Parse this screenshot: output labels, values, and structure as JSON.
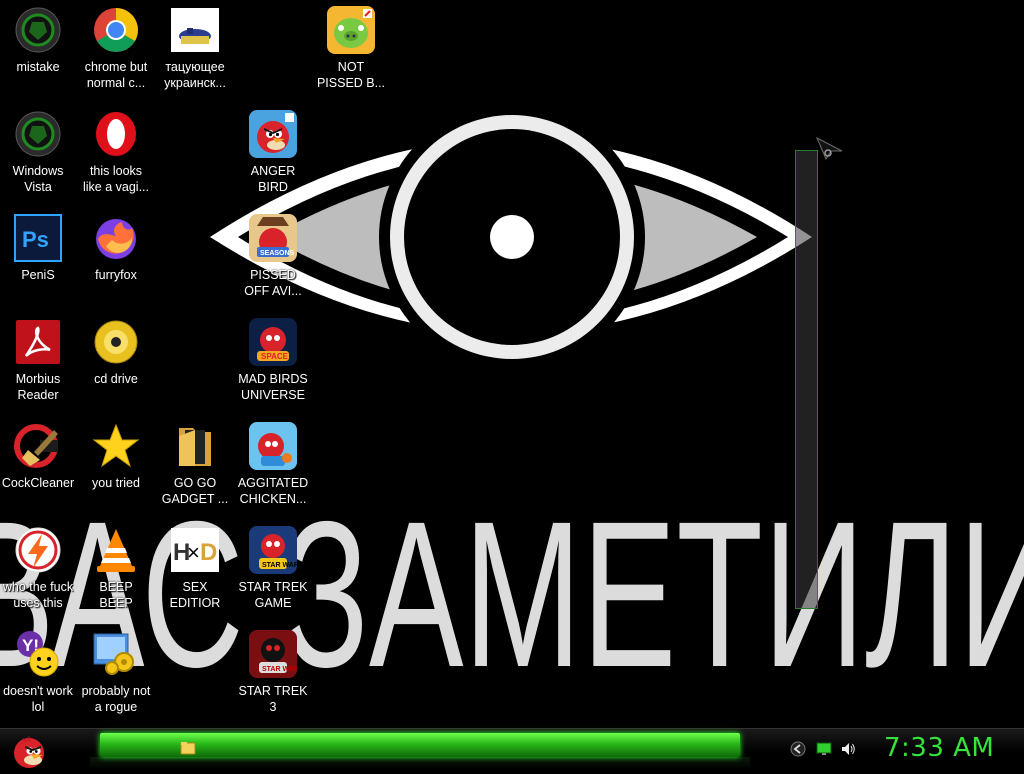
{
  "wallpaper": {
    "text": "ВАС ЗАМЕТИЛИ"
  },
  "desktop_icons": [
    {
      "id": "mistake",
      "label": "mistake",
      "icon": "razer-logo-icon"
    },
    {
      "id": "chrome",
      "label": "chrome but\nnormal c...",
      "icon": "chrome-icon"
    },
    {
      "id": "img-ru",
      "label": "тацующее\nукраинск...",
      "icon": "image-thumbnail-icon"
    },
    {
      "id": "not-pissed",
      "label": "NOT\nPISSED B...",
      "icon": "angry-birds-pig-icon"
    },
    {
      "id": "windows-vista",
      "label": "Windows\nVista",
      "icon": "razer-logo-icon"
    },
    {
      "id": "opera",
      "label": "this looks\nlike a vagi...",
      "icon": "opera-icon"
    },
    {
      "id": "anger-bird",
      "label": "ANGER\nBIRD",
      "icon": "angry-birds-icon"
    },
    {
      "id": "photoshop",
      "label": "PeniS",
      "icon": "photoshop-icon"
    },
    {
      "id": "firefox",
      "label": "furryfox",
      "icon": "firefox-icon"
    },
    {
      "id": "pissed-off",
      "label": "PISSED\nOFF AVI...",
      "icon": "angry-birds-seasons-icon"
    },
    {
      "id": "acrobat",
      "label": "Morbius\nReader",
      "icon": "acrobat-icon"
    },
    {
      "id": "cd-drive",
      "label": "cd drive",
      "icon": "cd-icon"
    },
    {
      "id": "mad-birds",
      "label": "MAD BIRDS\nUNIVERSE",
      "icon": "angry-birds-space-icon"
    },
    {
      "id": "ccleaner",
      "label": "CockCleaner",
      "icon": "ccleaner-icon"
    },
    {
      "id": "you-tried",
      "label": "you tried",
      "icon": "star-icon"
    },
    {
      "id": "go-go-gadget",
      "label": "GO GO\nGADGET ...",
      "icon": "folder-icon"
    },
    {
      "id": "agitated-chicken",
      "label": "AGGITATED\nCHICKEN...",
      "icon": "angry-birds-rio-icon"
    },
    {
      "id": "who-uses-this",
      "label": "who the fuck\nuses this",
      "icon": "lightning-icon"
    },
    {
      "id": "beep-beep",
      "label": "BEEP\nBEEP",
      "icon": "vlc-icon"
    },
    {
      "id": "sex-editor",
      "label": "SEX\nEDITIOR",
      "icon": "hxd-icon"
    },
    {
      "id": "star-trek-game",
      "label": "STAR TREK\nGAME",
      "icon": "angry-birds-star-wars-icon"
    },
    {
      "id": "yahoo",
      "label": "doesn't work\nlol",
      "icon": "yahoo-messenger-icon"
    },
    {
      "id": "rogue",
      "label": "probably not\na rogue",
      "icon": "control-panel-icon"
    },
    {
      "id": "star-trek-3",
      "label": "STAR TREK\n3",
      "icon": "angry-birds-star-wars-2-icon"
    }
  ],
  "taskbar": {
    "clock": "7:33 AM",
    "start_icon": "angry-bird-start-icon",
    "tray_icons": [
      "back-arrow-icon",
      "monitor-icon",
      "volume-icon"
    ],
    "accent_color": "#35e33a"
  }
}
